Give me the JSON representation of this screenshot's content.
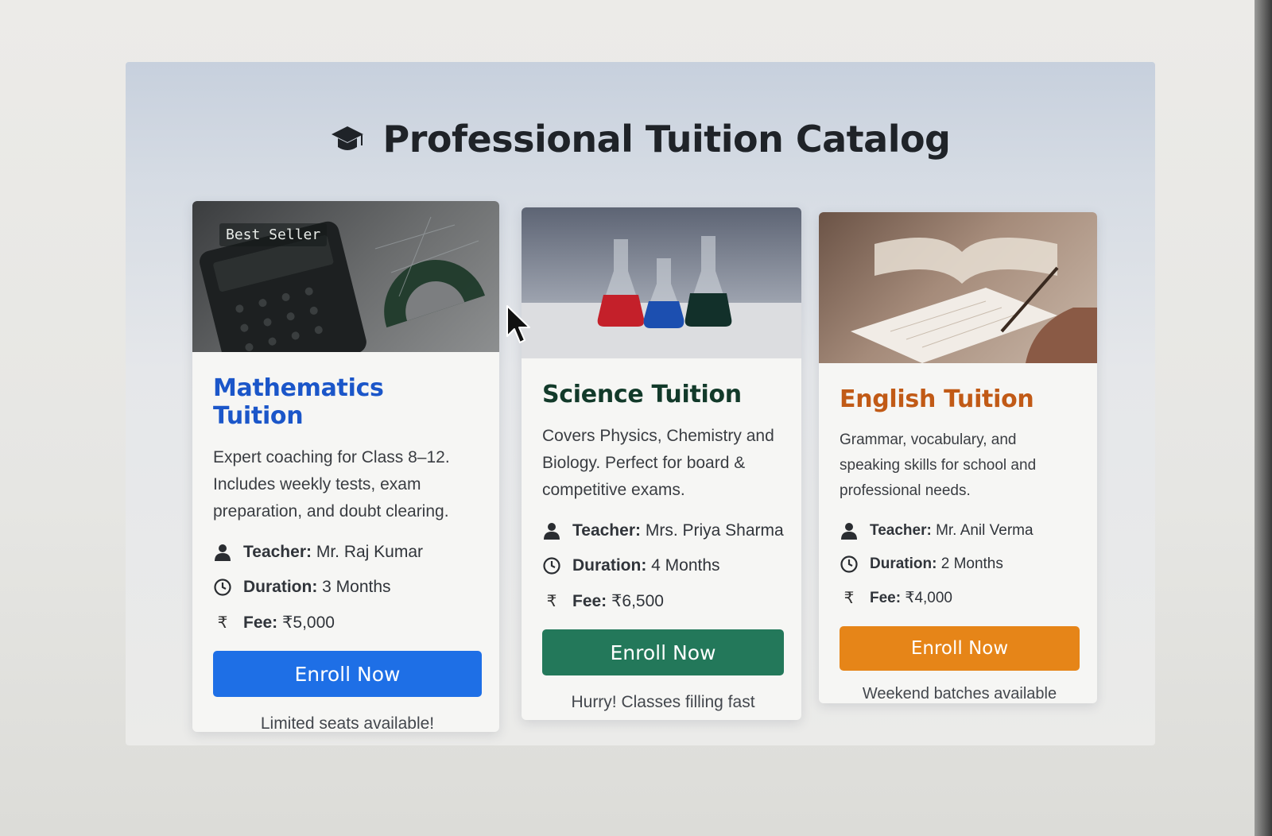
{
  "page": {
    "title": "Professional Tuition Catalog",
    "title_icon": "graduation-cap-icon"
  },
  "courses": [
    {
      "badge": "Best Seller",
      "image": "calculator-protractor-image",
      "title": "Mathematics Tuition",
      "description": "Expert coaching for Class 8–12. Includes weekly tests, exam preparation, and doubt clearing.",
      "teacher_label": "Teacher:",
      "teacher": "Mr. Raj Kumar",
      "duration_label": "Duration:",
      "duration": "3 Months",
      "fee_label": "Fee:",
      "fee": "₹5,000",
      "button": "Enroll Now",
      "note": "Limited seats available!",
      "accent": "#1e6fe6"
    },
    {
      "badge": "",
      "image": "lab-flasks-image",
      "title": "Science Tuition",
      "description": "Covers Physics, Chemistry and Biology. Perfect for board & competitive exams.",
      "teacher_label": "Teacher:",
      "teacher": "Mrs. Priya Sharma",
      "duration_label": "Duration:",
      "duration": "4 Months",
      "fee_label": "Fee:",
      "fee": "₹6,500",
      "button": "Enroll Now",
      "note": "Hurry! Classes filling fast",
      "accent": "#23785a"
    },
    {
      "badge": "",
      "image": "open-book-writing-image",
      "title": "English Tuition",
      "description": "Grammar, vocabulary, and speaking skills for school and professional needs.",
      "teacher_label": "Teacher:",
      "teacher": "Mr. Anil Verma",
      "duration_label": "Duration:",
      "duration": "2 Months",
      "fee_label": "Fee:",
      "fee": "₹4,000",
      "button": "Enroll Now",
      "note": "Weekend batches available",
      "accent": "#e68518"
    }
  ],
  "icons": {
    "teacher": "person-icon",
    "duration": "clock-icon",
    "fee": "rupee-icon",
    "rupee_glyph": "₹"
  }
}
